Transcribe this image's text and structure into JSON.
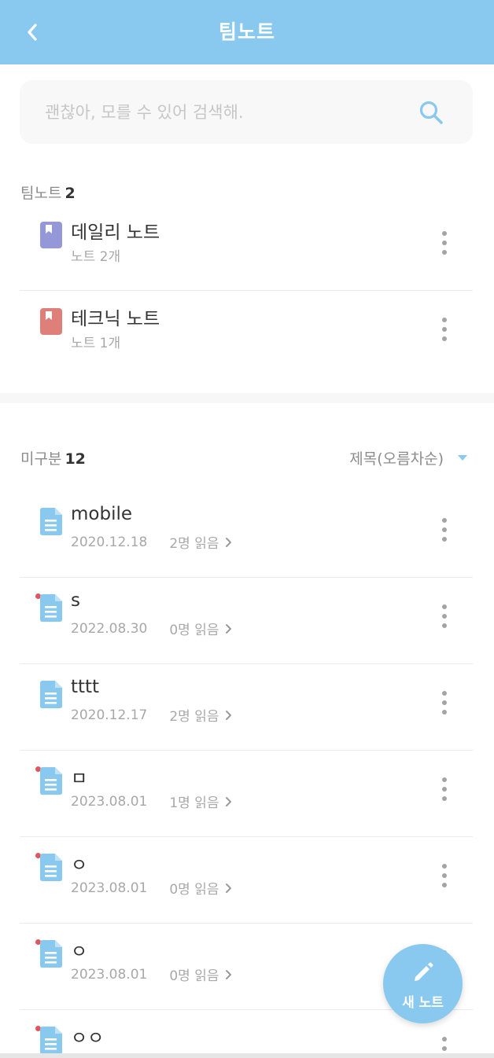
{
  "header": {
    "title": "팀노트",
    "back_icon": "chevron-left-icon"
  },
  "search": {
    "placeholder": "괜찮아, 모를 수 있어 검색해.",
    "value": "",
    "icon": "search-icon"
  },
  "teamnotes": {
    "label": "팀노트",
    "count": "2",
    "items": [
      {
        "title": "데일리 노트",
        "sub": "노트 2개",
        "color": "#9498d8",
        "icon": "bookmark-notebook-icon"
      },
      {
        "title": "테크닉 노트",
        "sub": "노트 1개",
        "color": "#df7f7a",
        "icon": "bookmark-notebook-icon"
      }
    ]
  },
  "uncategorized": {
    "label": "미구분",
    "count": "12",
    "sort": {
      "label": "제목(오름차순)",
      "icon": "caret-down-icon"
    },
    "notes": [
      {
        "title": "mobile",
        "date": "2020.12.18",
        "reads": "2명 읽음",
        "unread": false
      },
      {
        "title": "s",
        "date": "2022.08.30",
        "reads": "0명 읽음",
        "unread": true
      },
      {
        "title": "tttt",
        "date": "2020.12.17",
        "reads": "2명 읽음",
        "unread": false
      },
      {
        "title": "ㅁ",
        "date": "2023.08.01",
        "reads": "1명 읽음",
        "unread": true
      },
      {
        "title": "ㅇ",
        "date": "2023.08.01",
        "reads": "0명 읽음",
        "unread": true
      },
      {
        "title": "ㅇ",
        "date": "2023.08.01",
        "reads": "0명 읽음",
        "unread": true
      },
      {
        "title": "ㅇㅇ",
        "date": "",
        "reads": "",
        "unread": true
      }
    ]
  },
  "fab": {
    "label": "새 노트",
    "icon": "pencil-icon"
  },
  "colors": {
    "accent": "#89c9ef",
    "unread_dot": "#e4555b",
    "doc_icon": "#89c9ef"
  }
}
